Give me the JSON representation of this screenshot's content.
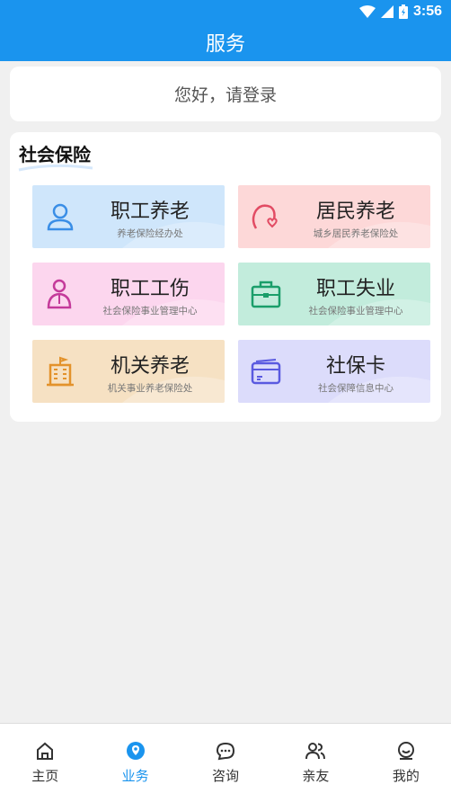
{
  "status": {
    "time": "3:56"
  },
  "header": {
    "title": "服务"
  },
  "login": {
    "text": "您好，请登录"
  },
  "section": {
    "title": "社会保险",
    "tiles": [
      {
        "title": "职工养老",
        "subtitle": "养老保险经办处",
        "icon": "person-icon"
      },
      {
        "title": "居民养老",
        "subtitle": "城乡居民养老保险处",
        "icon": "heart-face-icon"
      },
      {
        "title": "职工工伤",
        "subtitle": "社会保险事业管理中心",
        "icon": "worker-icon"
      },
      {
        "title": "职工失业",
        "subtitle": "社会保险事业管理中心",
        "icon": "briefcase-icon"
      },
      {
        "title": "机关养老",
        "subtitle": "机关事业养老保险处",
        "icon": "building-icon"
      },
      {
        "title": "社保卡",
        "subtitle": "社会保障信息中心",
        "icon": "card-icon"
      }
    ]
  },
  "tabs": [
    {
      "label": "主页",
      "icon": "home-icon"
    },
    {
      "label": "业务",
      "icon": "location-icon"
    },
    {
      "label": "咨询",
      "icon": "chat-icon"
    },
    {
      "label": "亲友",
      "icon": "people-icon"
    },
    {
      "label": "我的",
      "icon": "profile-icon"
    }
  ],
  "colors": {
    "accent": "#1a94ee",
    "tile_blue": "#cfe6fb",
    "tile_red": "#fdd8d8",
    "tile_pink": "#fcd6ee",
    "tile_green": "#c2ecdc",
    "tile_orange": "#f6e1c3",
    "tile_violet": "#dcdcfb"
  }
}
